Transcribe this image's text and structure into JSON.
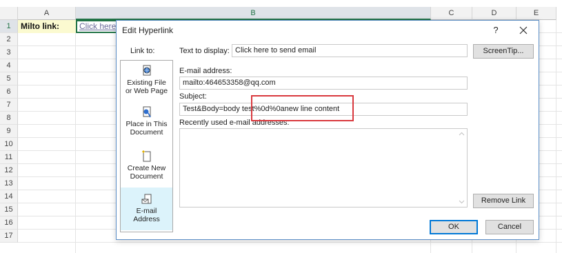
{
  "sheet": {
    "columns": [
      "A",
      "B",
      "C",
      "D",
      "E"
    ],
    "rows": [
      "1",
      "2",
      "3",
      "4",
      "5",
      "6",
      "7",
      "8",
      "9",
      "10",
      "11",
      "12",
      "13",
      "14",
      "15",
      "16",
      "17"
    ],
    "a1_text": "Milto link:",
    "b1_text": "Click here"
  },
  "dialog": {
    "title": "Edit Hyperlink",
    "help": "?",
    "link_to_label": "Link to:",
    "link_to_items": [
      {
        "line1": "Existing File",
        "line2": "or Web Page",
        "icon": "globe-file-icon"
      },
      {
        "line1": "Place in This",
        "line2": "Document",
        "icon": "document-location-icon"
      },
      {
        "line1": "Create New",
        "line2": "Document",
        "icon": "new-document-icon"
      },
      {
        "line1": "E-mail",
        "line2": "Address",
        "icon": "email-address-icon",
        "selected": true
      }
    ],
    "text_to_display_label": "Text to display:",
    "text_to_display_value": "Click here to send email",
    "screentip_label": "ScreenTip...",
    "email_address_label": "E-mail address:",
    "email_address_value": "mailto:464653358@qq.com",
    "subject_label": "Subject:",
    "subject_value": "Test&Body=body test%0d%0anew line content",
    "recent_label": "Recently used e-mail addresses:",
    "remove_link_label": "Remove Link",
    "ok_label": "OK",
    "cancel_label": "Cancel"
  },
  "colors": {
    "accent": "#217346",
    "highlight_box": "#d9383d",
    "selected_item": "#dcf3fb",
    "default_button": "#0078d7"
  }
}
